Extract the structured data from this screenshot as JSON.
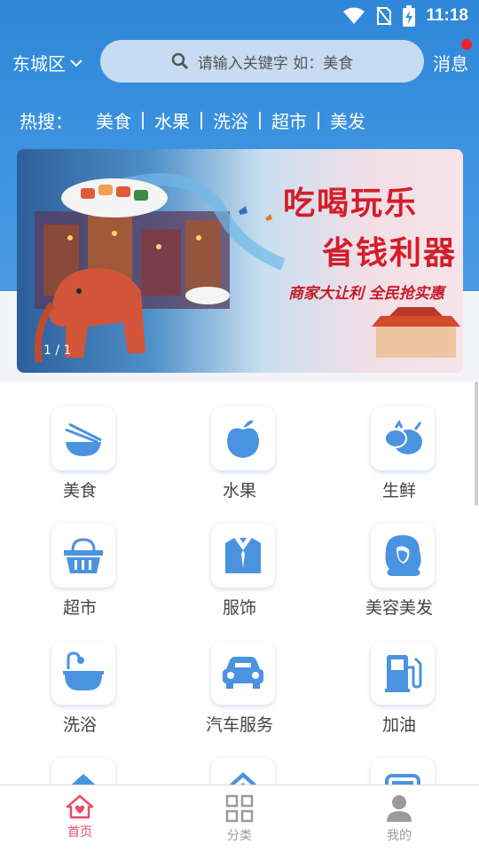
{
  "status_bar": {
    "time": "11:18"
  },
  "header": {
    "city": "东城区",
    "search_placeholder": "请输入关键字  如：美食",
    "message_label": "消息"
  },
  "hot_search": {
    "label": "热搜：",
    "items": [
      "美食",
      "水果",
      "洗浴",
      "超市",
      "美发"
    ]
  },
  "banner": {
    "title_line1": "吃喝玩乐",
    "title_line2": "省钱利器",
    "subtitle": "商家大让利 全民抢实惠",
    "indicator": "1 / 1"
  },
  "categories": [
    {
      "label": "美食",
      "icon": "bowl-chopsticks-icon"
    },
    {
      "label": "水果",
      "icon": "apple-icon"
    },
    {
      "label": "生鲜",
      "icon": "vegetables-icon"
    },
    {
      "label": "超市",
      "icon": "basket-icon"
    },
    {
      "label": "服饰",
      "icon": "suit-icon"
    },
    {
      "label": "美容美发",
      "icon": "woman-hair-icon"
    },
    {
      "label": "洗浴",
      "icon": "bathtub-icon"
    },
    {
      "label": "汽车服务",
      "icon": "car-icon"
    },
    {
      "label": "加油",
      "icon": "gas-pump-icon"
    },
    {
      "label": "",
      "icon": "house-icon"
    },
    {
      "label": "",
      "icon": "roof-icon"
    },
    {
      "label": "",
      "icon": "appliance-icon"
    }
  ],
  "bottom_nav": {
    "items": [
      {
        "label": "首页",
        "icon": "home-heart-icon",
        "active": true
      },
      {
        "label": "分类",
        "icon": "grid-icon",
        "active": false
      },
      {
        "label": "我的",
        "icon": "user-icon",
        "active": false
      }
    ]
  },
  "colors": {
    "header_blue": "#3d94e0",
    "icon_blue": "#4a93e0",
    "active_pink": "#ec4a6a",
    "banner_red": "#d41d2a"
  }
}
